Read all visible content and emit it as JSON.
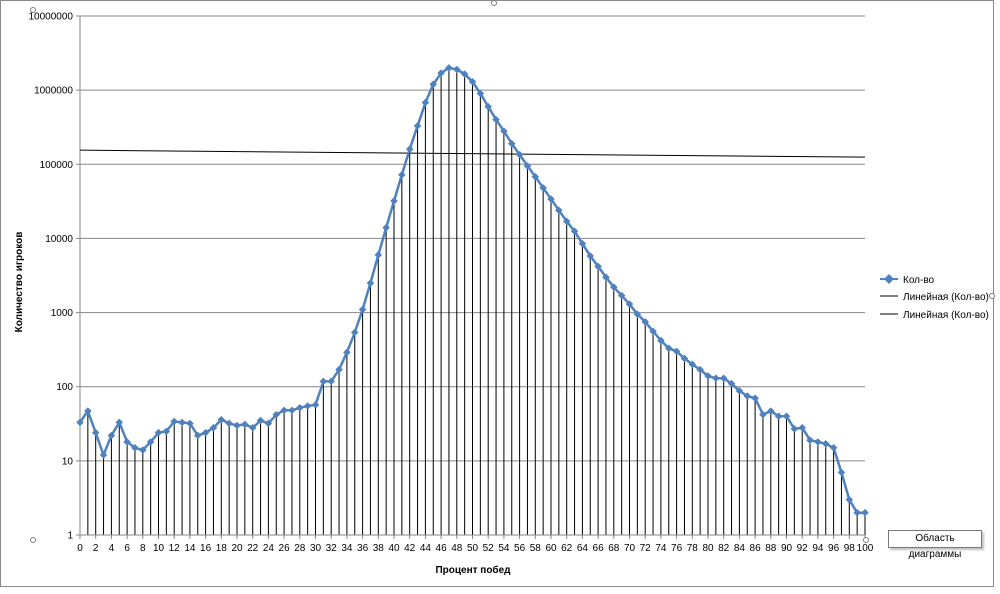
{
  "chart_data": {
    "type": "line",
    "title": "",
    "xlabel": "Процент побед",
    "ylabel": "Количество игроков",
    "yscale": "log",
    "ylim": [
      1,
      10000000
    ],
    "xlim": [
      0,
      100
    ],
    "grid": true,
    "legend_position": "right",
    "y_ticks": [
      "1",
      "10",
      "100",
      "1000",
      "10000",
      "100000",
      "1000000",
      "10000000"
    ],
    "x_ticks": [
      "0",
      "2",
      "4",
      "6",
      "8",
      "10",
      "12",
      "14",
      "16",
      "18",
      "20",
      "22",
      "24",
      "26",
      "28",
      "30",
      "32",
      "34",
      "36",
      "38",
      "40",
      "42",
      "44",
      "46",
      "48",
      "50",
      "52",
      "54",
      "56",
      "58",
      "60",
      "62",
      "64",
      "66",
      "68",
      "70",
      "72",
      "74",
      "76",
      "78",
      "80",
      "82",
      "84",
      "86",
      "88",
      "90",
      "92",
      "94",
      "96",
      "98",
      "100"
    ],
    "series": [
      {
        "name": "Кол-во",
        "color": "#4f81bd",
        "drop_lines": true,
        "x": [
          0,
          1,
          2,
          3,
          4,
          5,
          6,
          7,
          8,
          9,
          10,
          11,
          12,
          13,
          14,
          15,
          16,
          17,
          18,
          19,
          20,
          21,
          22,
          23,
          24,
          25,
          26,
          27,
          28,
          29,
          30,
          31,
          32,
          33,
          34,
          35,
          36,
          37,
          38,
          39,
          40,
          41,
          42,
          43,
          44,
          45,
          46,
          47,
          48,
          49,
          50,
          51,
          52,
          53,
          54,
          55,
          56,
          57,
          58,
          59,
          60,
          61,
          62,
          63,
          64,
          65,
          66,
          67,
          68,
          69,
          70,
          71,
          72,
          73,
          74,
          75,
          76,
          77,
          78,
          79,
          80,
          81,
          82,
          83,
          84,
          85,
          86,
          87,
          88,
          89,
          90,
          91,
          92,
          93,
          94,
          95,
          96,
          97,
          98,
          99,
          100
        ],
        "y": [
          33,
          47,
          24,
          12,
          22,
          33,
          18,
          15,
          14,
          18,
          24,
          25,
          34,
          33,
          32,
          22,
          24,
          28,
          36,
          32,
          30,
          31,
          28,
          35,
          32,
          42,
          48,
          48,
          52,
          55,
          57,
          118,
          118,
          170,
          290,
          540,
          1100,
          2500,
          6000,
          14000,
          32000,
          72000,
          160000,
          330000,
          680000,
          1200000,
          1700000,
          2000000,
          1900000,
          1650000,
          1300000,
          900000,
          600000,
          400000,
          280000,
          190000,
          135000,
          95000,
          68000,
          48000,
          34000,
          24000,
          17000,
          12500,
          8500,
          5800,
          4200,
          3000,
          2200,
          1700,
          1300,
          950,
          750,
          560,
          420,
          330,
          300,
          240,
          200,
          170,
          140,
          130,
          130,
          110,
          88,
          75,
          70,
          42,
          47,
          40,
          40,
          27,
          28,
          19,
          18,
          17,
          15,
          7,
          3,
          2,
          2
        ]
      },
      {
        "name": "Линейная (Кол-во)",
        "color": "#000000",
        "x": [
          0,
          100
        ],
        "y": [
          155000,
          125000
        ]
      },
      {
        "name": "Линейная (Кол-во)",
        "color": "#000000",
        "x": [],
        "y": []
      }
    ]
  },
  "tooltip_text": "Область диаграммы"
}
